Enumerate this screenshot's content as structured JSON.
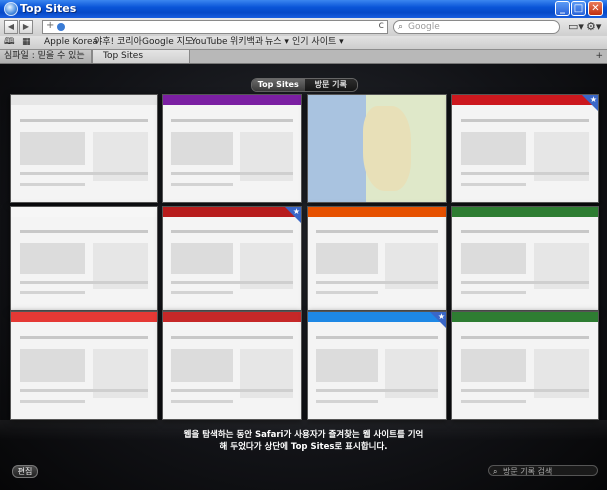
{
  "window": {
    "title": "Top Sites",
    "minimize": "_",
    "maximize": "□",
    "close": "✕"
  },
  "toolbar": {
    "back": "◀",
    "forward": "▶",
    "url_value": "",
    "search_placeholder": "Google",
    "reload": "c",
    "add": "+"
  },
  "bookmarks": [
    {
      "label": "Apple Korea"
    },
    {
      "label": "야후! 코리아"
    },
    {
      "label": "Google 지도"
    },
    {
      "label": "YouTube"
    },
    {
      "label": "위키백과"
    },
    {
      "label": "뉴스 ▾"
    },
    {
      "label": "인기 사이트 ▾"
    }
  ],
  "tabs": [
    {
      "label": "심파일 : 믿을 수 있는",
      "active": false
    },
    {
      "label": "Top Sites",
      "active": true
    }
  ],
  "newtab": "+",
  "content": {
    "segments": [
      {
        "label": "Top Sites",
        "active": true
      },
      {
        "label": "방문 기록",
        "active": false
      }
    ],
    "message_line1": "웹을 탐색하는 동안 Safari가 사용자가 즐겨찾는 웹 사이트를 기억",
    "message_line2": "해 두었다가 상단에 Top Sites로 표시합니다.",
    "edit_label": "편집",
    "history_search_placeholder": "방문 기록 검색"
  },
  "thumbnails": [
    {
      "name": "apple",
      "header_color": "#e6e6e6",
      "starred": false
    },
    {
      "name": "yahoo-korea",
      "header_color": "#7b1fa2",
      "starred": false
    },
    {
      "name": "google-maps",
      "header_color": "#ffffff",
      "starred": false
    },
    {
      "name": "youtube",
      "header_color": "#cc181e",
      "starred": true
    },
    {
      "name": "wikipedia",
      "header_color": "#f6f6f6",
      "starred": false
    },
    {
      "name": "news-site",
      "header_color": "#b71c1c",
      "starred": true
    },
    {
      "name": "shopping-site",
      "header_color": "#e65100",
      "starred": false
    },
    {
      "name": "portal-site",
      "header_color": "#2e7d32",
      "starred": false
    },
    {
      "name": "nate",
      "header_color": "#e53935",
      "starred": false
    },
    {
      "name": "news-site-2",
      "header_color": "#c62828",
      "starred": false
    },
    {
      "name": "daum",
      "header_color": "#1e88e5",
      "starred": true
    },
    {
      "name": "hankyoreh",
      "header_color": "#2e7d32",
      "starred": false
    }
  ]
}
